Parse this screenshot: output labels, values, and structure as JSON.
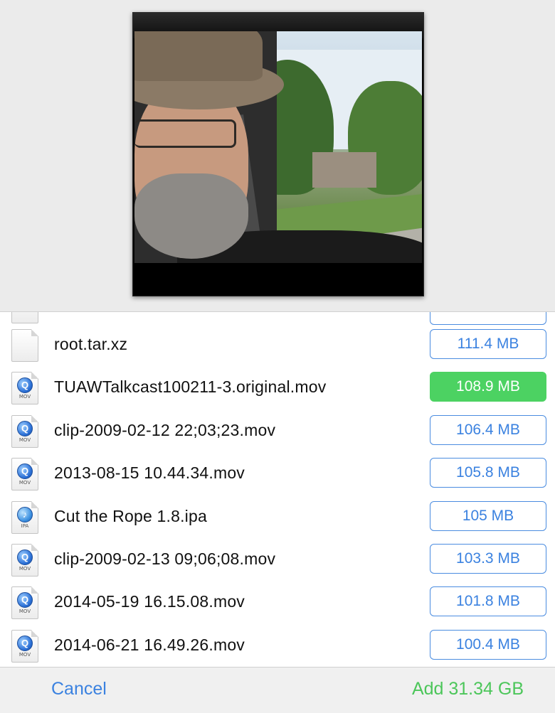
{
  "files": [
    {
      "name": "root.tar.xz",
      "size": "111.4 MB",
      "icon": "generic-file-icon",
      "ext": "",
      "selected": false
    },
    {
      "name": "TUAWTalkcast100211-3.original.mov",
      "size": "108.9 MB",
      "icon": "quicktime-movie-icon",
      "ext": "MOV",
      "selected": true
    },
    {
      "name": "clip-2009-02-12 22;03;23.mov",
      "size": "106.4 MB",
      "icon": "quicktime-movie-icon",
      "ext": "MOV",
      "selected": false
    },
    {
      "name": "2013-08-15 10.44.34.mov",
      "size": "105.8 MB",
      "icon": "quicktime-movie-icon",
      "ext": "MOV",
      "selected": false
    },
    {
      "name": "Cut the Rope 1.8.ipa",
      "size": "105 MB",
      "icon": "ipa-app-icon",
      "ext": "IPA",
      "selected": false
    },
    {
      "name": "clip-2009-02-13 09;06;08.mov",
      "size": "103.3 MB",
      "icon": "quicktime-movie-icon",
      "ext": "MOV",
      "selected": false
    },
    {
      "name": "2014-05-19 16.15.08.mov",
      "size": "101.8 MB",
      "icon": "quicktime-movie-icon",
      "ext": "MOV",
      "selected": false
    },
    {
      "name": "2014-06-21 16.49.26.mov",
      "size": "100.4 MB",
      "icon": "quicktime-movie-icon",
      "ext": "MOV",
      "selected": false
    }
  ],
  "footer": {
    "cancel_label": "Cancel",
    "add_label": "Add 31.34 GB"
  },
  "colors": {
    "accent_blue": "#3b82e0",
    "selected_green": "#4cd262",
    "add_green": "#4cc65a"
  }
}
